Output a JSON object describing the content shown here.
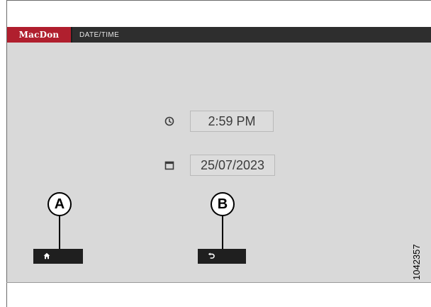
{
  "header": {
    "brand": "MacDon",
    "title": "DATE/TIME",
    "brand_color": "#b01f2e"
  },
  "time": {
    "icon": "clock-icon",
    "value": "2:59 PM"
  },
  "date": {
    "icon": "calendar-icon",
    "value": "25/07/2023"
  },
  "softkeys": {
    "home_icon": "home-icon",
    "back_icon": "back-arrow-icon"
  },
  "callouts": {
    "a": "A",
    "b": "B"
  },
  "figure_number": "1042357"
}
